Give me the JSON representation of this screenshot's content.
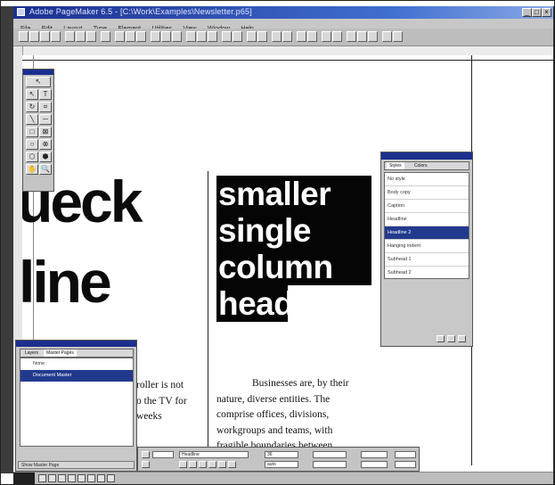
{
  "window": {
    "title": "Adobe PageMaker 6.5 - [C:\\Work\\Examples\\Newsletter.p65]"
  },
  "menu": [
    "File",
    "Edit",
    "Layout",
    "Type",
    "Element",
    "Utilities",
    "View",
    "Window",
    "Help"
  ],
  "page": {
    "big_head_line1": "ueck",
    "big_head_line2": "line",
    "highlight_lines": [
      "smaller",
      "single",
      "column",
      "head"
    ],
    "left_body_lines": [
      "roller is not",
      "o the TV for",
      "weeks"
    ],
    "right_body_lines": [
      "Businesses are, by their",
      "nature, diverse entities. The",
      "comprise offices, divisions,",
      "workgroups and teams, with",
      "fragible boundaries between"
    ]
  },
  "styles_palette": {
    "tab_styles": "Styles",
    "tab_colors": "Colors",
    "items": [
      "No style",
      "Body copy",
      "Caption",
      "Headline",
      "Headline 2",
      "Hanging indent",
      "Subhead 1",
      "Subhead 2"
    ],
    "selected_index": 4
  },
  "master_pages_palette": {
    "tab_layers": "Layers",
    "tab_master": "Master Pages",
    "items": [
      "None",
      "Document Master"
    ],
    "selected_index": 1,
    "footer": "Show Master Page"
  },
  "control_palette": {
    "font_field": "Headline",
    "size_field": "36",
    "leading_field": "auto"
  }
}
